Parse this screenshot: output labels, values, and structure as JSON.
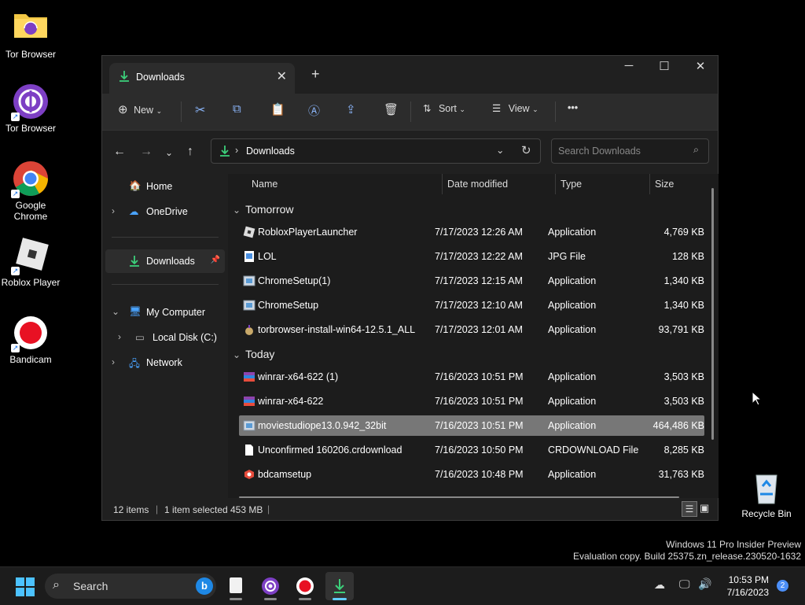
{
  "desktop": {
    "icons": [
      {
        "label": "Tor Browser"
      },
      {
        "label": "Tor Browser"
      },
      {
        "label": "Google Chrome"
      },
      {
        "label": "Roblox Player"
      },
      {
        "label": "Bandicam"
      },
      {
        "label": "Recycle Bin"
      }
    ],
    "watermark_line1": "Windows 11 Pro Insider Preview",
    "watermark_line2": "Evaluation copy. Build 25375.zn_release.230520-1632"
  },
  "explorer": {
    "tab_title": "Downloads",
    "new_tab": "+",
    "toolbar": {
      "new_label": "New",
      "sort_label": "Sort",
      "view_label": "View",
      "more_label": "•••"
    },
    "address": {
      "path": "Downloads"
    },
    "search": {
      "placeholder": "Search Downloads"
    },
    "nav": {
      "home": "Home",
      "onedrive": "OneDrive",
      "downloads": "Downloads",
      "my_computer": "My Computer",
      "local_disk": "Local Disk (C:)",
      "network": "Network"
    },
    "columns": {
      "name": "Name",
      "date": "Date modified",
      "type": "Type",
      "size": "Size"
    },
    "groups": [
      {
        "title": "Tomorrow",
        "files": [
          {
            "name": "RobloxPlayerLauncher",
            "date": "7/17/2023 12:26 AM",
            "type": "Application",
            "size": "4,769 KB",
            "icon": "roblox"
          },
          {
            "name": "LOL",
            "date": "7/17/2023 12:22 AM",
            "type": "JPG File",
            "size": "128 KB",
            "icon": "image"
          },
          {
            "name": "ChromeSetup(1)",
            "date": "7/17/2023 12:15 AM",
            "type": "Application",
            "size": "1,340 KB",
            "icon": "setup"
          },
          {
            "name": "ChromeSetup",
            "date": "7/17/2023 12:10 AM",
            "type": "Application",
            "size": "1,340 KB",
            "icon": "setup"
          },
          {
            "name": "torbrowser-install-win64-12.5.1_ALL",
            "date": "7/17/2023 12:01 AM",
            "type": "Application",
            "size": "93,791 KB",
            "icon": "tor"
          }
        ]
      },
      {
        "title": "Today",
        "files": [
          {
            "name": "winrar-x64-622 (1)",
            "date": "7/16/2023 10:51 PM",
            "type": "Application",
            "size": "3,503 KB",
            "icon": "winrar"
          },
          {
            "name": "winrar-x64-622",
            "date": "7/16/2023 10:51 PM",
            "type": "Application",
            "size": "3,503 KB",
            "icon": "winrar"
          },
          {
            "name": "moviestudiope13.0.942_32bit",
            "date": "7/16/2023 10:51 PM",
            "type": "Application",
            "size": "464,486 KB",
            "icon": "setup",
            "selected": true
          },
          {
            "name": "Unconfirmed 160206.crdownload",
            "date": "7/16/2023 10:50 PM",
            "type": "CRDOWNLOAD File",
            "size": "8,285 KB",
            "icon": "doc"
          },
          {
            "name": "bdcamsetup",
            "date": "7/16/2023 10:48 PM",
            "type": "Application",
            "size": "31,763 KB",
            "icon": "bandicam"
          }
        ]
      }
    ],
    "status": {
      "items": "12 items",
      "selected": "1 item selected",
      "size": "453 MB"
    }
  },
  "taskbar": {
    "search_label": "Search",
    "time": "10:53 PM",
    "date": "7/16/2023",
    "notification_count": "2"
  },
  "colors": {
    "selection": "#777777",
    "accent": "#60cdff",
    "download_green": "#3ccf7a"
  }
}
